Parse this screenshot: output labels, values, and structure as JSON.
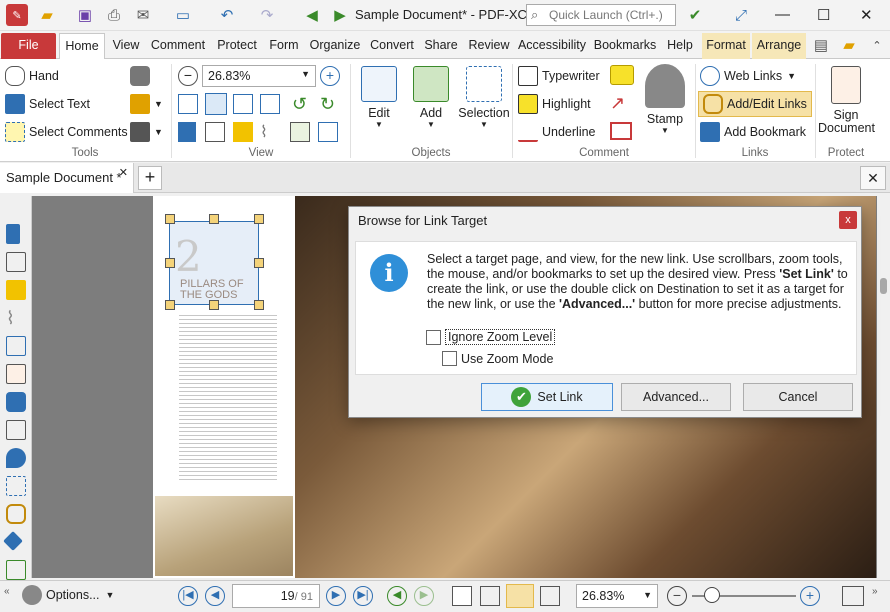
{
  "window": {
    "title": "Sample Document* - PDF-XCh..."
  },
  "search": {
    "placeholder": "Quick Launch (Ctrl+.)"
  },
  "tabs": [
    {
      "label": "File"
    },
    {
      "label": "Home"
    },
    {
      "label": "View"
    },
    {
      "label": "Comment"
    },
    {
      "label": "Protect"
    },
    {
      "label": "Form"
    },
    {
      "label": "Organize"
    },
    {
      "label": "Convert"
    },
    {
      "label": "Share"
    },
    {
      "label": "Review"
    },
    {
      "label": "Accessibility"
    },
    {
      "label": "Bookmarks"
    },
    {
      "label": "Help"
    },
    {
      "label": "Format"
    },
    {
      "label": "Arrange"
    }
  ],
  "ribbon": {
    "tools": {
      "label": "Tools",
      "hand": "Hand",
      "select_text": "Select Text",
      "select_comments": "Select Comments"
    },
    "view": {
      "label": "View",
      "zoom": "26.83%"
    },
    "objects": {
      "label": "Objects",
      "edit": "Edit",
      "add": "Add",
      "selection": "Selection"
    },
    "comment": {
      "label": "Comment",
      "typewriter": "Typewriter",
      "highlight": "Highlight",
      "underline": "Underline",
      "stamp": "Stamp"
    },
    "links": {
      "label": "Links",
      "web_links": "Web Links",
      "add_edit_links": "Add/Edit Links",
      "add_bookmark": "Add Bookmark"
    },
    "protect": {
      "label": "Protect",
      "sign_line1": "Sign",
      "sign_line2": "Document"
    }
  },
  "document": {
    "tab_label": "Sample Document *",
    "page_big_numeral": "2",
    "page_heading_line1": "PILLARS OF",
    "page_heading_line2": "THE GODS"
  },
  "dialog": {
    "title": "Browse for Link Target",
    "close_glyph": "x",
    "message_part1": "Select a target page, and view, for the new link. Use scrollbars, zoom tools, the mouse, and/or bookmarks to set up the desired view. Press ",
    "message_bold1": "'Set Link'",
    "message_part2": " to create the link, or use the double click on Destination to set it as a target for the new link, or use the ",
    "message_bold2": "'Advanced...'",
    "message_part3": " button for more precise adjustments.",
    "ignore_zoom": "Ignore Zoom Level",
    "use_zoom_mode": "Use Zoom Mode",
    "set_link": "Set Link",
    "advanced": "Advanced...",
    "cancel": "Cancel"
  },
  "status": {
    "options": "Options...",
    "page_current": "19",
    "page_total": "/ 91",
    "zoom": "26.83%"
  }
}
